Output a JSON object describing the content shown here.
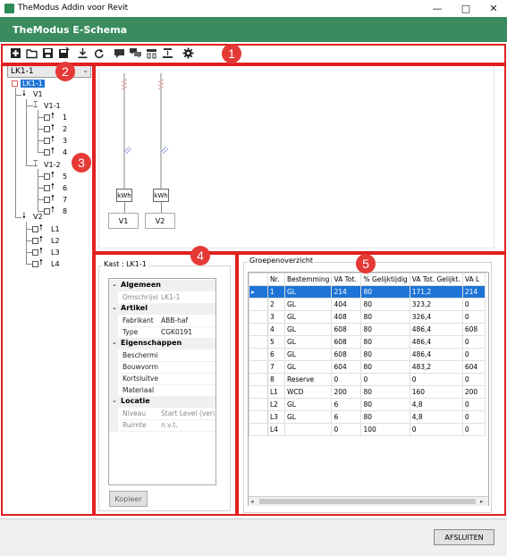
{
  "window": {
    "title": "TheModus Addin voor Revit",
    "minimize_glyph": "—",
    "maximize_glyph": "□",
    "close_glyph": "✕"
  },
  "header": {
    "title": "TheModus E-Schema"
  },
  "toolbar": {
    "icons": [
      "add-icon",
      "open-folder-icon",
      "save-icon",
      "save-as-icon",
      "download-icon",
      "refresh-icon",
      "comment-icon",
      "comments-icon",
      "layout-icon",
      "align-icon",
      "settings-icon"
    ]
  },
  "badges": [
    "1",
    "2",
    "3",
    "4",
    "5"
  ],
  "combo": {
    "value": "LK1-1",
    "arrow": "⌄"
  },
  "tree": {
    "root": "LK1-1",
    "v1": "V1",
    "v1_1": "V1-1",
    "v1_1_items": [
      "1",
      "2",
      "3",
      "4"
    ],
    "v1_2": "V1-2",
    "v1_2_items": [
      "5",
      "6",
      "7",
      "8"
    ],
    "v2": "V2",
    "v2_items": [
      "L1",
      "L2",
      "L3",
      "L4"
    ]
  },
  "diagram": {
    "meter_label": "kWh",
    "feeders": [
      "V1",
      "V2"
    ]
  },
  "kast": {
    "title": "Kast : LK1-1",
    "properties": [
      {
        "type": "cat",
        "label": "Algemeen"
      },
      {
        "type": "row",
        "label": "Omschrijvir",
        "value": "LK1-1",
        "grey": true
      },
      {
        "type": "cat",
        "label": "Artikel"
      },
      {
        "type": "row",
        "label": "Fabrikant",
        "value": "ABB-haf",
        "grey": false
      },
      {
        "type": "row",
        "label": "Type",
        "value": "CGK0191",
        "grey": false
      },
      {
        "type": "cat",
        "label": "Eigenschappen"
      },
      {
        "type": "row",
        "label": "Beschermir",
        "value": "",
        "grey": false
      },
      {
        "type": "row",
        "label": "Bouwvorm",
        "value": "",
        "grey": false
      },
      {
        "type": "row",
        "label": "Kortsluitver",
        "value": "",
        "grey": false
      },
      {
        "type": "row",
        "label": "Materiaal",
        "value": "",
        "grey": false
      },
      {
        "type": "cat",
        "label": "Locatie"
      },
      {
        "type": "row",
        "label": "Niveau",
        "value": "Start Level (verwi",
        "grey": true
      },
      {
        "type": "row",
        "label": "Ruimte",
        "value": "n.v.t.",
        "grey": true
      }
    ],
    "copy_button": "Kopieer"
  },
  "groepen": {
    "title": "Groepenoverzicht",
    "columns": [
      "Nr.",
      "Bestemming",
      "VA Tot.",
      "% Gelijktijdig",
      "VA Tot. Gelijkt.",
      "VA L"
    ],
    "rows": [
      [
        "1",
        "GL",
        "214",
        "80",
        "171,2",
        "214"
      ],
      [
        "2",
        "GL",
        "404",
        "80",
        "323,2",
        "0"
      ],
      [
        "3",
        "GL",
        "408",
        "80",
        "326,4",
        "0"
      ],
      [
        "4",
        "GL",
        "608",
        "80",
        "486,4",
        "608"
      ],
      [
        "5",
        "GL",
        "608",
        "80",
        "486,4",
        "0"
      ],
      [
        "6",
        "GL",
        "608",
        "80",
        "486,4",
        "0"
      ],
      [
        "7",
        "GL",
        "604",
        "80",
        "483,2",
        "604"
      ],
      [
        "8",
        "Reserve",
        "0",
        "0",
        "0",
        "0"
      ],
      [
        "L1",
        "WCD",
        "200",
        "80",
        "160",
        "200"
      ],
      [
        "L2",
        "GL",
        "6",
        "80",
        "4,8",
        "0"
      ],
      [
        "L3",
        "GL",
        "6",
        "80",
        "4,8",
        "0"
      ],
      [
        "L4",
        "",
        "0",
        "100",
        "0",
        "0"
      ]
    ],
    "selected_row": 0,
    "row_marker": "▸"
  },
  "footer": {
    "close_button": "AFSLUITEN"
  },
  "colors": {
    "header_bg": "#3a8c5e",
    "annotation_red": "#e02020",
    "selection_blue": "#1e74d6"
  }
}
